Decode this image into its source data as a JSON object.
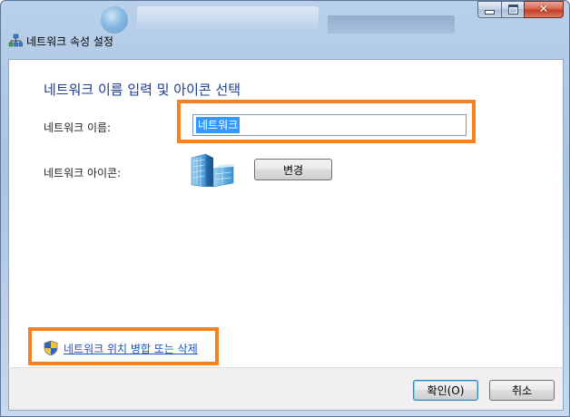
{
  "window": {
    "title": "네트워크 속성 설정",
    "caption_buttons": {
      "minimize": "minimize",
      "maximize": "maximize",
      "close": "close"
    }
  },
  "dialog": {
    "heading": "네트워크 이름 입력 및 아이콘 선택",
    "name_label": "네트워크 이름:",
    "name_value": "네트워크",
    "icon_label": "네트워크 아이콘:",
    "change_button": "변경",
    "merge_link": "네트워크 위치 병합 또는 삭제"
  },
  "footer": {
    "ok_button": "확인(O)",
    "cancel_button": "취소"
  },
  "colors": {
    "heading": "#1a3d8f",
    "link": "#1a53c8",
    "highlight": "#f5821f",
    "selection": "#3399ff"
  },
  "icons": [
    "network-tree-icon",
    "network-building-icon",
    "uac-shield-icon"
  ]
}
